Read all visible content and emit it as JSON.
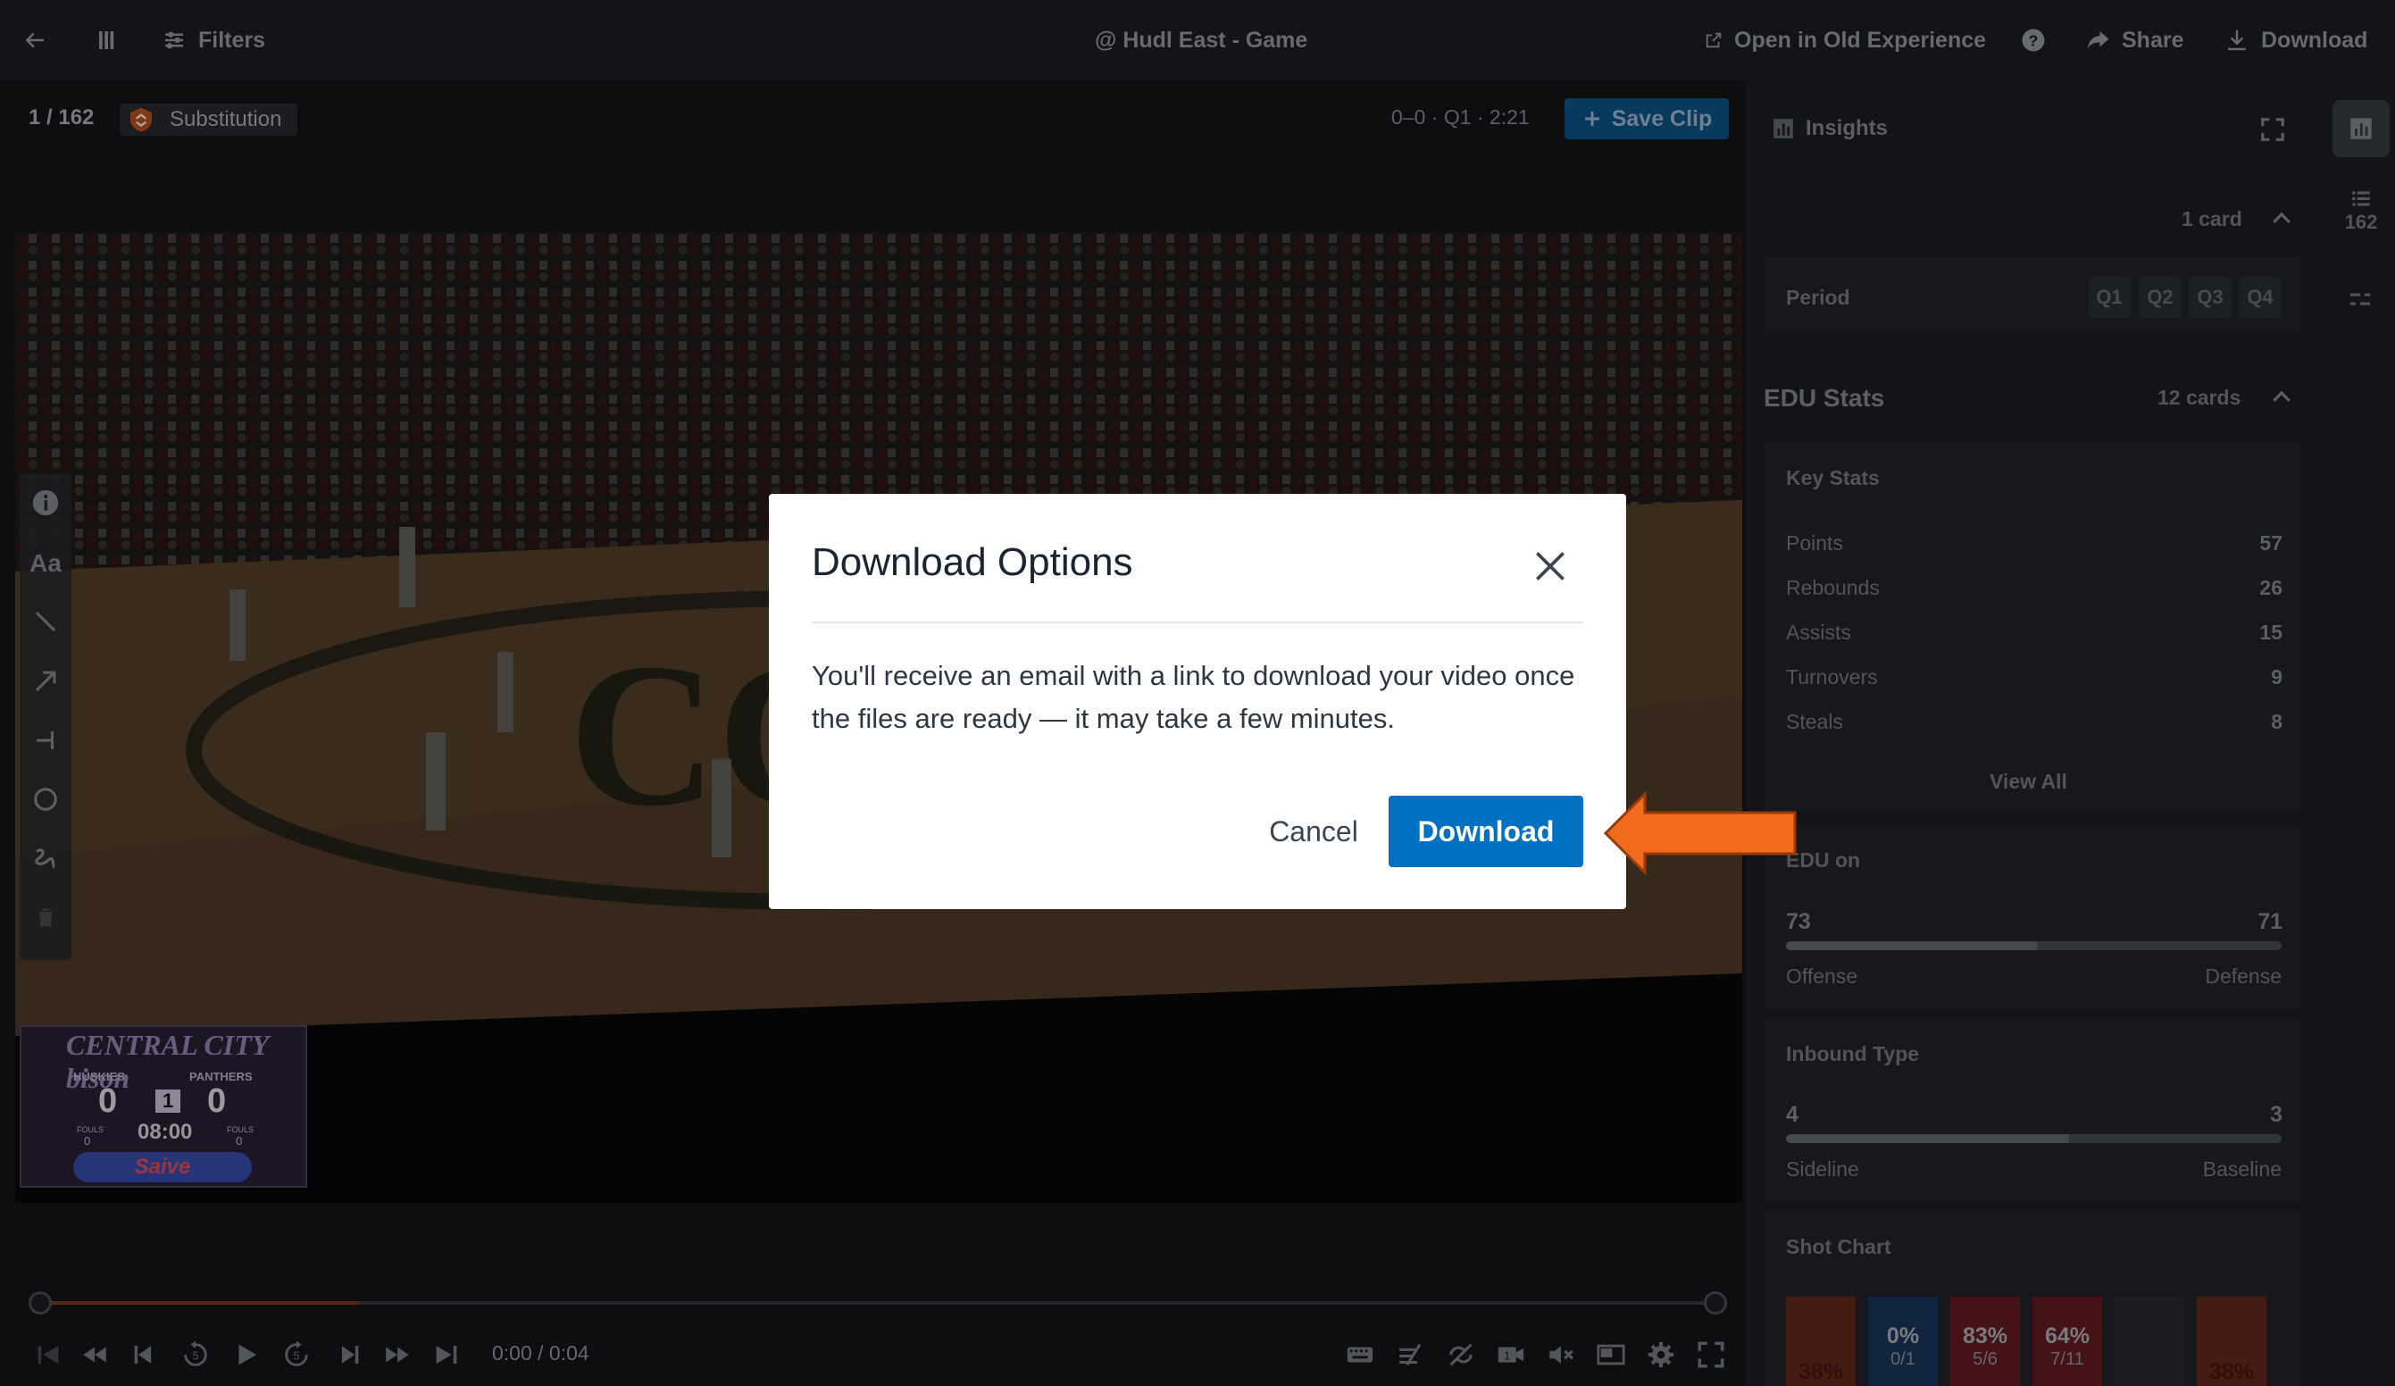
{
  "topbar": {
    "filters_label": "Filters",
    "game_title": "@ Hudl East - Game",
    "old_experience_label": "Open in Old Experience",
    "share_label": "Share",
    "download_label": "Download"
  },
  "clip": {
    "counter": "1 / 162",
    "play_type": "Substitution",
    "score_info": "0–0 · Q1 · 2:21",
    "save_clip_label": "Save Clip"
  },
  "player": {
    "time": "0:00 / 0:04",
    "progress_fraction": 0.19
  },
  "scoreboard": {
    "banner": "CENTRAL CITY bison",
    "home_team": "HUSKIES",
    "away_team": "PANTHERS",
    "home_score": "0",
    "away_score": "0",
    "period": "1",
    "clock": "08:00",
    "sponsor": "Saive",
    "fouls_label": "FOULS",
    "home_fouls": "0",
    "away_fouls": "0"
  },
  "insights": {
    "title": "Insights",
    "card_count": "1 card",
    "period_label": "Period",
    "periods": [
      "Q1",
      "Q2",
      "Q3",
      "Q4"
    ]
  },
  "edu_stats": {
    "title": "EDU Stats",
    "card_count": "12 cards",
    "key_stats_title": "Key Stats",
    "key_stats": [
      {
        "label": "Points",
        "value": "57"
      },
      {
        "label": "Rebounds",
        "value": "26"
      },
      {
        "label": "Assists",
        "value": "15"
      },
      {
        "label": "Turnovers",
        "value": "9"
      },
      {
        "label": "Steals",
        "value": "8"
      }
    ],
    "view_all_label": "View All",
    "edu_on": {
      "title": "EDU on",
      "left_value": "73",
      "right_value": "71",
      "left_label": "Offense",
      "right_label": "Defense"
    },
    "inbound": {
      "title": "Inbound Type",
      "left_value": "4",
      "right_value": "3",
      "left_label": "Sideline",
      "right_label": "Baseline"
    },
    "shot_chart_title": "Shot Chart",
    "shot_chart": [
      {
        "pct": "38%",
        "made": "",
        "color": "#6b2a1e"
      },
      {
        "pct": "0%",
        "made": "0/1",
        "color": "#1d3a63"
      },
      {
        "pct": "83%",
        "made": "5/6",
        "color": "#6b1d22"
      },
      {
        "pct": "64%",
        "made": "7/11",
        "color": "#6b1d22"
      },
      {
        "pct": "",
        "made": "",
        "color": "#2a2d33"
      },
      {
        "pct": "38%",
        "made": "",
        "color": "#6b2a1e"
      }
    ]
  },
  "rail": {
    "clips_count": "162"
  },
  "modal": {
    "title": "Download Options",
    "message": "You'll receive an email with a link to download your video once the files are ready — it may take a few minutes.",
    "cancel_label": "Cancel",
    "download_label": "Download"
  },
  "colors": {
    "accent": "#0070c0",
    "callout_arrow": "#f26b1d"
  }
}
